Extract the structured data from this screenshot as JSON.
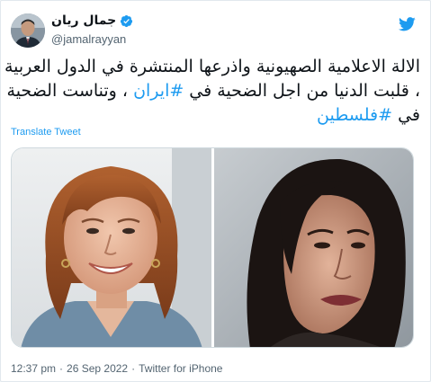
{
  "author": {
    "display_name": "جمال ريان",
    "handle": "@jamalrayyan",
    "verified": true,
    "avatar_icon": "user-avatar"
  },
  "brand": {
    "logo_icon": "twitter-bird-icon",
    "color": "#1d9bf0"
  },
  "tweet": {
    "line1": "الالة الاعلامية الصهيونية واذرعها المنتشرة في الدول العربية",
    "line2_prefix": "، قلبت الدنيا من اجل الضحية في ",
    "line2_hashtag": "#ايران",
    "line2_suffix": " ، وتناست الضحية",
    "line3_prefix": "في ",
    "line3_hashtag": "#فلسطين"
  },
  "translate_label": "Translate Tweet",
  "media": {
    "photos": [
      {
        "alt_icon": "photo-woman-smiling"
      },
      {
        "alt_icon": "photo-woman-portrait"
      }
    ]
  },
  "meta": {
    "time": "12:37 pm",
    "date": "26 Sep 2022",
    "source": "Twitter for iPhone",
    "separator": "·"
  },
  "colors": {
    "text": "#0f1419",
    "secondary": "#536471",
    "link": "#1d9bf0",
    "border": "#cfd9de"
  }
}
